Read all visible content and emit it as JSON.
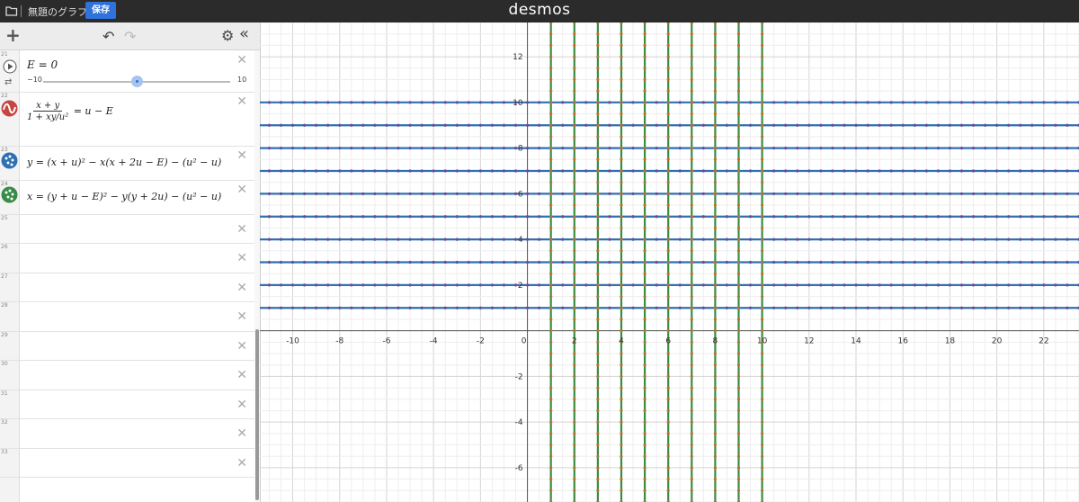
{
  "app": {
    "file_title": "無題のグラフ",
    "save_label": "保存",
    "brand": "desmos"
  },
  "toolbar": {
    "add": "+",
    "undo": "↶",
    "redo": "↷",
    "settings": "⚙",
    "collapse": "«"
  },
  "expressions": [
    {
      "num": "21",
      "icon": "play-icon",
      "text": "E = 0",
      "slider_min": "−10",
      "slider_max": "10",
      "slider_value": 0
    },
    {
      "num": "22",
      "icon": "implicit-curve-icon",
      "color": "#c74440",
      "lhs_num": "x + y",
      "lhs_den": "1 + xy/u²",
      "rhs": "= u − E"
    },
    {
      "num": "23",
      "icon": "points-icon",
      "color": "#2d70b3",
      "text": "y = (x + u)² − x(x + 2u − E) − (u² − u)"
    },
    {
      "num": "24",
      "icon": "points-icon",
      "color": "#388c46",
      "text": "x = (y + u − E)² − y(y + 2u) − (u² − u)"
    },
    {
      "num": "25"
    },
    {
      "num": "26"
    },
    {
      "num": "27"
    },
    {
      "num": "28"
    },
    {
      "num": "29"
    },
    {
      "num": "30"
    },
    {
      "num": "31"
    },
    {
      "num": "32"
    },
    {
      "num": "33"
    }
  ],
  "keyboard_icon": "keyboard-icon",
  "graph": {
    "x_range": [
      -11.4,
      23.5
    ],
    "y_range": [
      -7.5,
      13.5
    ],
    "x_tick_labels": [
      "-10",
      "-8",
      "-6",
      "-4",
      "-2",
      "0",
      "2",
      "4",
      "6",
      "8",
      "10",
      "12",
      "14",
      "16",
      "18",
      "20",
      "22"
    ],
    "y_tick_labels": [
      "12",
      "10",
      "8",
      "6",
      "4",
      "2",
      "-2",
      "-4",
      "-6"
    ],
    "horizontal_lines_y": [
      1,
      2,
      3,
      4,
      5,
      6,
      7,
      8,
      9,
      10
    ],
    "vertical_lines_x": [
      1,
      2,
      3,
      4,
      5,
      6,
      7,
      8,
      9,
      10
    ],
    "horizontal_color": "#2d70b3",
    "vertical_color": "#388c46",
    "point_color_h": "#6a4c93",
    "point_color_v": "#c07020"
  }
}
